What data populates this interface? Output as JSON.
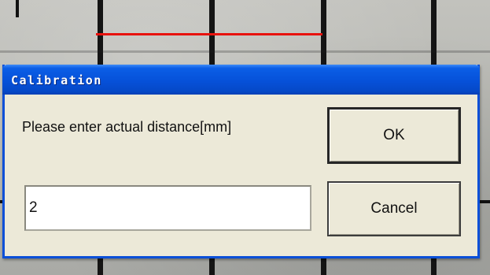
{
  "dialog": {
    "title": "Calibration",
    "prompt": "Please enter actual distance[mm]",
    "ok_label": "OK",
    "cancel_label": "Cancel",
    "distance_value": "2"
  },
  "colors": {
    "titlebar": "#0651d9",
    "dialog_face": "#ece9d8",
    "measure_line": "#e8120e"
  }
}
